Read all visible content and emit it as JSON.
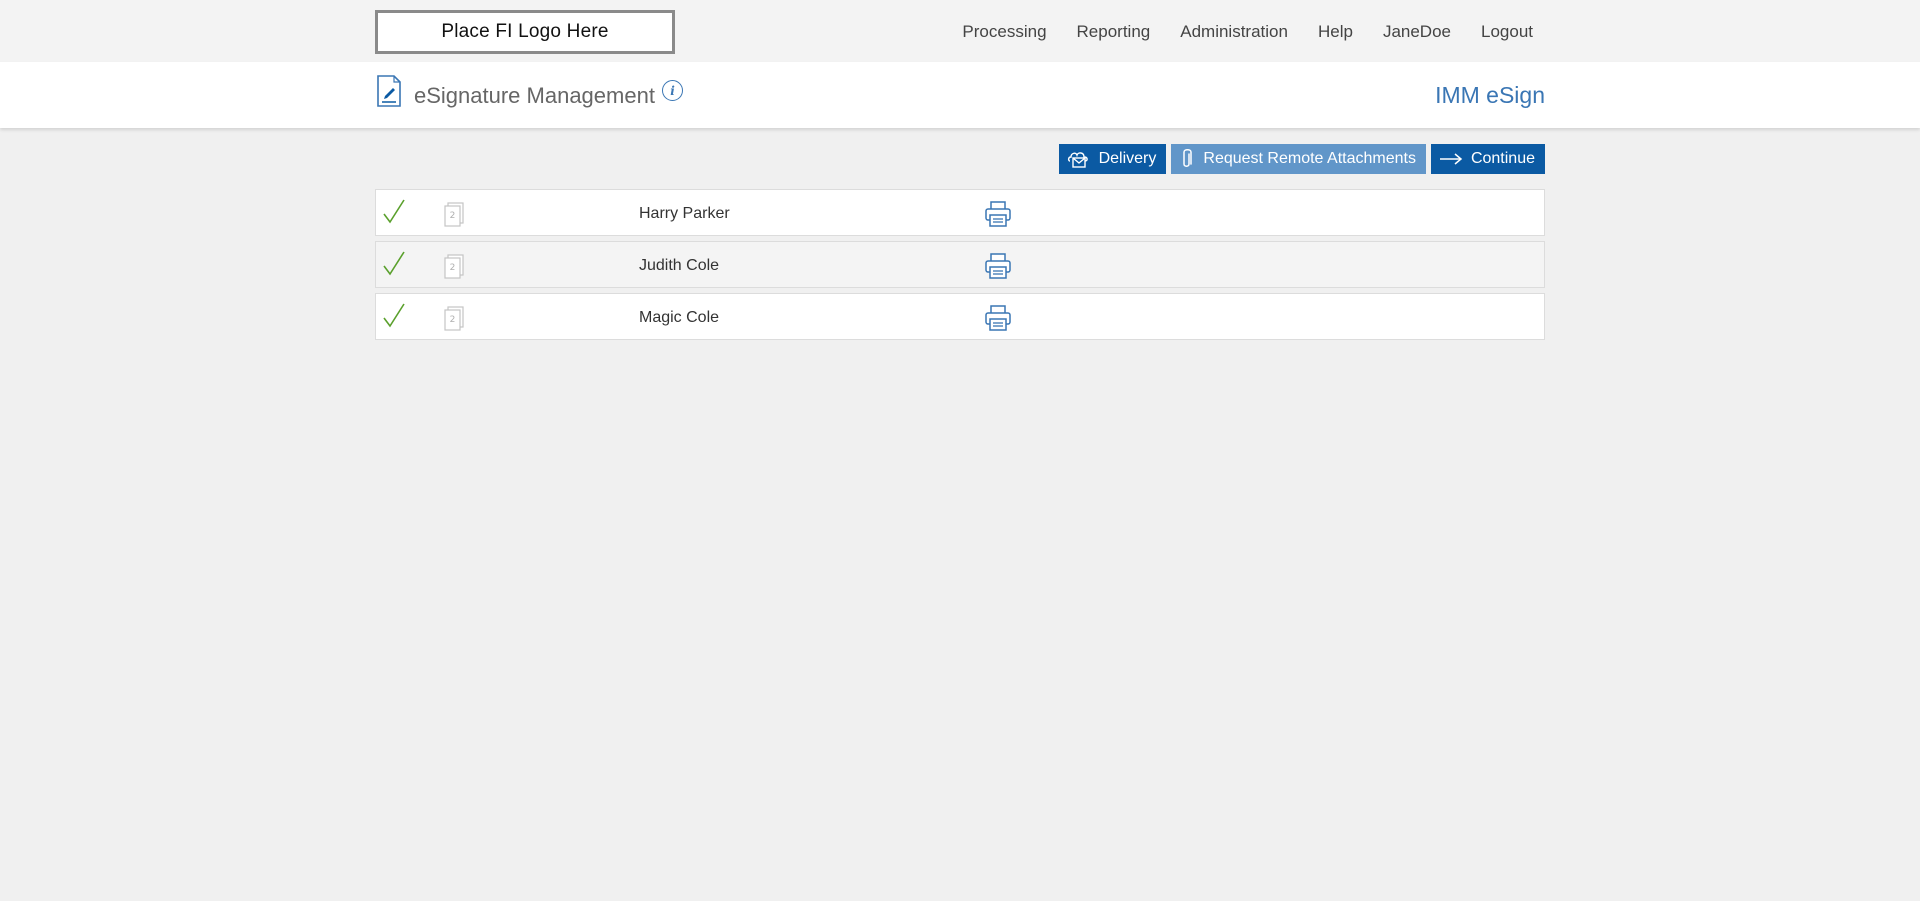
{
  "topbar": {
    "logo_text": "Place FI Logo Here",
    "nav": [
      {
        "label": "Processing"
      },
      {
        "label": "Reporting"
      },
      {
        "label": "Administration"
      },
      {
        "label": "Help"
      },
      {
        "label": "JaneDoe"
      },
      {
        "label": "Logout"
      }
    ]
  },
  "header": {
    "title": "eSignature Management",
    "info_icon": "info-icon",
    "brand": "IMM eSign"
  },
  "toolbar": {
    "delivery_label": "Delivery",
    "attachments_label": "Request Remote Attachments",
    "continue_label": "Continue"
  },
  "signers": [
    {
      "name": "Harry Parker",
      "status": "complete",
      "doc_count": "2"
    },
    {
      "name": "Judith Cole",
      "status": "complete",
      "doc_count": "2"
    },
    {
      "name": "Magic Cole",
      "status": "complete",
      "doc_count": "2"
    }
  ],
  "colors": {
    "primary": "#0b5aa3",
    "muted_button": "#6196c9",
    "brand_text": "#3a76b4",
    "check": "#5aa02c"
  }
}
